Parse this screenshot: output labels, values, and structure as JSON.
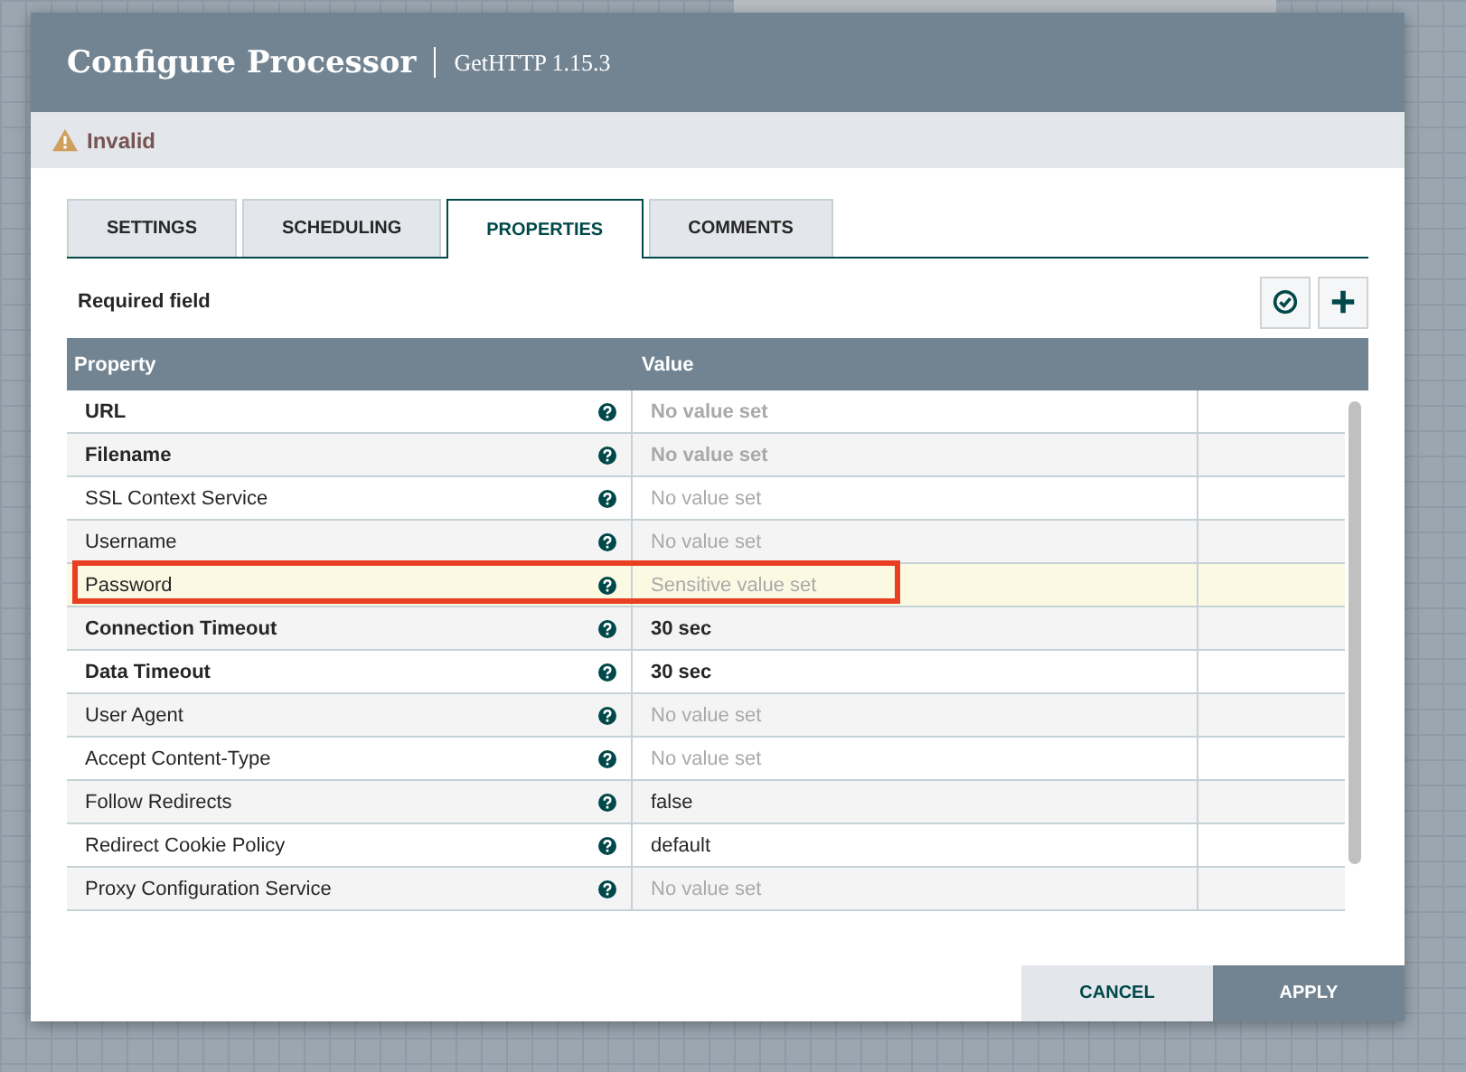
{
  "dialog": {
    "title": "Configure Processor",
    "subtitle": "GetHTTP 1.15.3"
  },
  "status": {
    "kind": "warning",
    "text": "Invalid"
  },
  "tabs": [
    {
      "label": "SETTINGS",
      "selected": false
    },
    {
      "label": "SCHEDULING",
      "selected": false
    },
    {
      "label": "PROPERTIES",
      "selected": true
    },
    {
      "label": "COMMENTS",
      "selected": false
    }
  ],
  "required_label": "Required field",
  "table": {
    "columns": [
      "Property",
      "Value"
    ],
    "rows": [
      {
        "name": "URL",
        "required": true,
        "value": "No value set",
        "greyed": true,
        "selected": false,
        "outlined": false
      },
      {
        "name": "Filename",
        "required": true,
        "value": "No value set",
        "greyed": true,
        "selected": false,
        "outlined": false
      },
      {
        "name": "SSL Context Service",
        "required": false,
        "value": "No value set",
        "greyed": true,
        "selected": false,
        "outlined": false
      },
      {
        "name": "Username",
        "required": false,
        "value": "No value set",
        "greyed": true,
        "selected": false,
        "outlined": false
      },
      {
        "name": "Password",
        "required": false,
        "value": "Sensitive value set",
        "greyed": true,
        "selected": true,
        "outlined": true
      },
      {
        "name": "Connection Timeout",
        "required": true,
        "value": "30 sec",
        "greyed": false,
        "selected": false,
        "outlined": false
      },
      {
        "name": "Data Timeout",
        "required": true,
        "value": "30 sec",
        "greyed": false,
        "selected": false,
        "outlined": false
      },
      {
        "name": "User Agent",
        "required": false,
        "value": "No value set",
        "greyed": true,
        "selected": false,
        "outlined": false
      },
      {
        "name": "Accept Content-Type",
        "required": false,
        "value": "No value set",
        "greyed": true,
        "selected": false,
        "outlined": false
      },
      {
        "name": "Follow Redirects",
        "required": false,
        "value": "false",
        "greyed": false,
        "selected": false,
        "outlined": false
      },
      {
        "name": "Redirect Cookie Policy",
        "required": false,
        "value": "default",
        "greyed": false,
        "selected": false,
        "outlined": false
      },
      {
        "name": "Proxy Configuration Service",
        "required": false,
        "value": "No value set",
        "greyed": true,
        "selected": false,
        "outlined": false
      }
    ]
  },
  "buttons": [
    {
      "label": "CANCEL",
      "kind": "secondary"
    },
    {
      "label": "APPLY",
      "kind": "primary"
    }
  ]
}
